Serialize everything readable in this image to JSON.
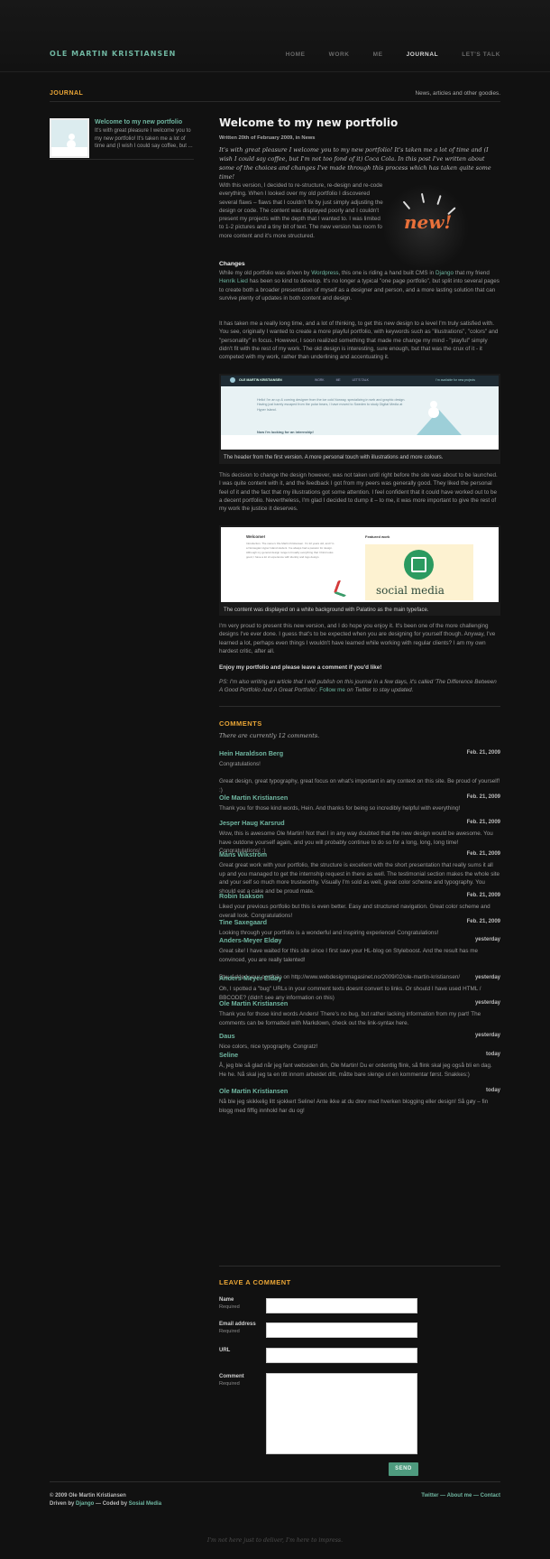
{
  "header": {
    "logo": "OLE MARTIN KRISTIANSEN",
    "nav": [
      "HOME",
      "WORK",
      "ME",
      "JOURNAL",
      "LET'S TALK"
    ]
  },
  "section": {
    "title": "JOURNAL",
    "tagline": "News, articles and other goodies."
  },
  "sidebar_post": {
    "title": "Welcome to my new portfolio",
    "excerpt": "It's with great pleasure I welcome you to my new portfolio! It's taken me a lot of time and (I wish I could say coffee, but ..."
  },
  "post": {
    "title": "Welcome to my new portfolio",
    "meta": "Written 20th of February 2009, in News",
    "intro": "It's with great pleasure I welcome you to my new portfolio! It's taken me a lot of time and (I wish I could say coffee, but I'm not too fond of it) Coca Cola. In this post I've written about some of the choices and changes I've made through this process which has taken quite some time!",
    "p1": "With this version, I decided to re-structure, re-design and re-code everything. When I looked over my old portfolio I discovered several flaws – flaws that I couldn't fix by just simply adjusting the design or code. The content was displayed poorly and I couldn't present my projects with the depth that I wanted to. I was limited to 1-2 pictures and a tiny bit of text. The new version has room for more content and it's more structured.",
    "badge": "new!",
    "changes_heading": "Changes",
    "p2_a": "While my old portfolio was driven by ",
    "p2_link1": "Wordpress",
    "p2_b": ", this one is riding a hand built CMS in ",
    "p2_link2": "Django",
    "p2_c": " that my friend ",
    "p2_link3": "Henrik Lied",
    "p2_d": " has been so kind to develop. It's no longer a typical \"one page portfolio\", but split into several pages to create both a broader presentation of myself as a designer and person, and a more lasting solution that can survive plenty of updates in both content and design.",
    "p3": "It has taken me a really long time, and a lot of thinking, to get this new design to a level I'm truly satisfied with. You see, originally I wanted to create a more playful portfolio, with keywords such as \"illustrations\", \"colors\" and \"personality\" in focus. However, I soon realized something that made me change my mind - \"playful\" simply didn't fit with the rest of my work. The old design is interesting, sure enough, but that was the crux of it - it competed with my work, rather than underlining and accentuating it.",
    "caption1": "The header from the first version. A more personal touch with illustrations and more colours.",
    "p4": "This decision to change the design however, was not taken until right before the site was about to be launched. I was quite content with it, and the feedback I got from my peers was generally good. They liked the personal feel of it and the fact that my illustrations got some attention. I feel confident that it could have worked out to be a decent portfolio. Nevertheless, I'm glad I decided to dump it – to me, it was more important to give the rest of my work the justice it deserves.",
    "caption2": "The content was displayed on a white background with Palatino as the main typeface.",
    "p5": "I'm very proud to present this new version, and I do hope you enjoy it. It's been one of the more challenging designs I've ever done. I guess that's to be expected when you are designing for yourself though. Anyway, I've learned a lot, perhaps even things I wouldn't have learned while working with regular clients? I am my own hardest critic, after all.",
    "p6": "Enjoy my portfolio and please leave a comment if you'd like!",
    "ps_a": "PS: I'm also writing an article that I will publish on this journal in a few days, it's called 'The Difference Between A Good Portfolio And A Great Portfolio'. ",
    "ps_link": "Follow me",
    "ps_b": " on Twitter to stay updated."
  },
  "shot1": {
    "logo": "OLE MARTIN KRISTIANSEN",
    "nav": [
      "WORK",
      "ME",
      "LET'S TALK"
    ],
    "avail": "I'm available for new projects",
    "hello": "Hello! I'm an up & coming designer from the ice cold Norway, specializing in web and graphic design. Having just barely escaped from the polar bears, I have moved to Sweden to study Digital Media at Hyper Island.",
    "intern": "Now I'm looking for an internship!"
  },
  "shot2": {
    "welcome": "Welcome!",
    "body": "Introduction. The name's Ole Martin Kristiansen. I'm 22 years old, and I'm a Norwegian Hyper Island student. I've always had a passion for design. Although my general design range is broadly everything that I think looks good, I have a lot of experience with identity and logo design.",
    "featured": "Featured work",
    "brand": "social media"
  },
  "comments": {
    "heading": "COMMENTS",
    "count": "There are currently 12 comments.",
    "items": [
      {
        "author": "Hein Haraldson Berg",
        "date": "Feb. 21, 2009",
        "text": "Congratulations!\n\nGreat design, great typography, great focus on what's important in any context on this site. Be proud of yourself! :)"
      },
      {
        "author": "Ole Martin Kristiansen",
        "date": "Feb. 21, 2009",
        "text": "Thank you for those kind words, Hein. And thanks for being so incredibly helpful with everything!"
      },
      {
        "author": "Jesper Haug Karsrud",
        "date": "Feb. 21, 2009",
        "text": "Wow, this is awesome Ole Martin! Not that I in any way doubted that the new design would be awesome. You have outdone yourself again, and you will probably continue to do so for a long, long, long time! Congratulations! :)"
      },
      {
        "author": "Måns Wikström",
        "date": "Feb. 21, 2009",
        "text": "Great great work with your portfolio, the structure is excellent with the short presentation that really sums it all up and you managed to get the internship request in there as well. The testimonial section makes the whole site and your self so much more trustworthy. Visually I'm sold as well, great color scheme and typography. You should eat a cake and be proud mate."
      },
      {
        "author": "Robin Isakson",
        "date": "Feb. 21, 2009",
        "text": "Liked your previous portfolio but this is even better. Easy and structured navigation. Great color scheme and overall look. Congratulations!"
      },
      {
        "author": "Tine Saxegaard",
        "date": "Feb. 21, 2009",
        "text": "Looking through your portfolio is a wonderful and inspiring experience! Congratulations!"
      },
      {
        "author": "Anders-Meyer Eldøy",
        "date": "yesterday",
        "text": "Great site! I have waited for this site since I first saw your HL-blog on Styleboost. And the result has me convinced, you are really talented!\n\nBtw. Added your portfolio on http://www.webdesignmagasinet.no/2009/02/ole-martin-kristiansen/"
      },
      {
        "author": "Anders-Meyer Eldøy",
        "date": "yesterday",
        "text": "Oh, I spotted a \"bug\" URLs in your comment texts doesnt convert to links. Or should I have used HTML / BBCODE? (didn't see any information on this)"
      },
      {
        "author": "Ole Martin Kristiansen",
        "date": "yesterday",
        "text": "Thank you for those kind words Anders! There's no bug, but rather lacking information from my part! The comments can be formatted with Markdown, check out the link-syntax here."
      },
      {
        "author": "Daus",
        "date": "yesterday",
        "text": "Nice colors, nice typography. Congratz!"
      },
      {
        "author": "Seline",
        "date": "today",
        "text": "Å, jeg ble så glad når jeg fant websiden din, Ole Martin! Du er ordentlig flink, så flink skal jeg også bli en dag. He he. Nå skal jeg ta en titt innom arbeidet ditt, måtte bare slenge ut en kommentar først. Snakkes:)"
      },
      {
        "author": "Ole Martin Kristiansen",
        "date": "today",
        "text": "Nå ble jeg skikkelig litt sjokkert Seline! Ante ikke at du drev med hverken blogging eller design! Så gøy – fin blogg med fiffig innhold har du og!"
      }
    ]
  },
  "form": {
    "heading": "LEAVE A COMMENT",
    "name": "Name",
    "email": "Email address",
    "url": "URL",
    "comment": "Comment",
    "required": "Required",
    "send": "SEND"
  },
  "footer": {
    "copy": "© 2009 Ole Martin Kristiansen",
    "driven_a": "Driven by ",
    "driven_link": "Django",
    "driven_b": " — Coded by ",
    "coded_link": "Sosial Media",
    "twitter": "Twitter",
    "about": "About me",
    "contact": "Contact",
    "sep": " — ",
    "tagline": "I'm not here just to deliver, I'm here to impress."
  }
}
